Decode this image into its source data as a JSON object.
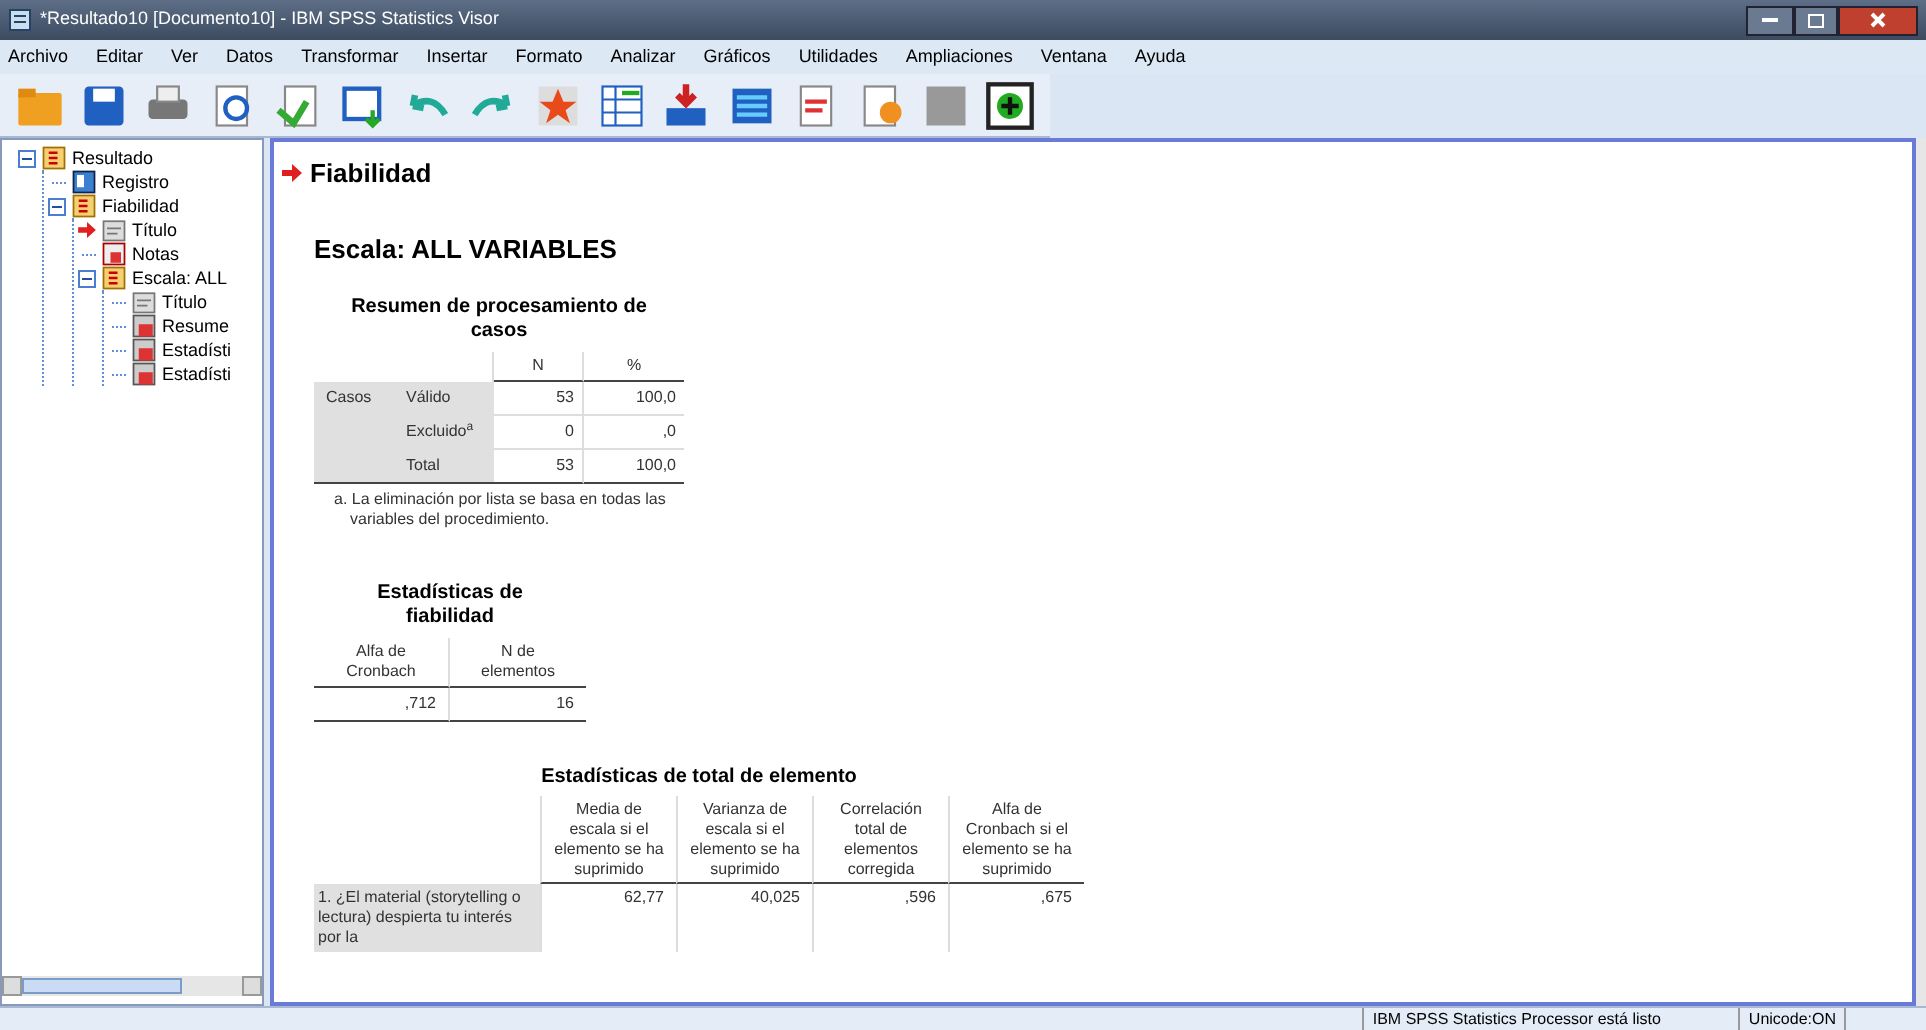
{
  "window": {
    "title": "*Resultado10 [Documento10] - IBM SPSS Statistics Visor"
  },
  "menu": [
    "Archivo",
    "Editar",
    "Ver",
    "Datos",
    "Transformar",
    "Insertar",
    "Formato",
    "Analizar",
    "Gráficos",
    "Utilidades",
    "Ampliaciones",
    "Ventana",
    "Ayuda"
  ],
  "toolbar": [
    {
      "kind": "open"
    },
    {
      "kind": "save"
    },
    {
      "kind": "print"
    },
    {
      "kind": "preview"
    },
    {
      "kind": "export"
    },
    {
      "kind": "recall"
    },
    {
      "kind": "undo"
    },
    {
      "kind": "redo"
    },
    {
      "kind": "star"
    },
    {
      "kind": "goto"
    },
    {
      "kind": "insert"
    },
    {
      "kind": "variables"
    },
    {
      "kind": "doc"
    },
    {
      "kind": "script"
    },
    {
      "kind": "gray"
    },
    {
      "kind": "add"
    }
  ],
  "tree": [
    {
      "label": "Resultado",
      "kind": "log",
      "expanded": true,
      "children": [
        {
          "label": "Registro",
          "kind": "book",
          "selected": false
        },
        {
          "label": "Fiabilidad",
          "kind": "log",
          "expanded": true,
          "children": [
            {
              "label": "Título",
              "kind": "title",
              "selected": true
            },
            {
              "label": "Notas",
              "kind": "notes",
              "selected": false
            },
            {
              "label": "Escala: ALL",
              "kind": "log",
              "expanded": true,
              "children": [
                {
                  "label": "Título",
                  "kind": "title",
                  "selected": false
                },
                {
                  "label": "Resume",
                  "kind": "table",
                  "selected": false
                },
                {
                  "label": "Estadísti",
                  "kind": "table",
                  "selected": false
                },
                {
                  "label": "Estadísti",
                  "kind": "table",
                  "selected": false
                }
              ]
            }
          ]
        }
      ]
    }
  ],
  "output": {
    "heading": "Fiabilidad",
    "subheading": "Escala: ALL VARIABLES",
    "summary": {
      "title": "Resumen de procesamiento de casos",
      "columns": [
        "N",
        "%"
      ],
      "group": "Casos",
      "rows": [
        [
          "Válido",
          "53",
          "100,0"
        ],
        [
          "Excluido$^{a}$",
          "0",
          ",0"
        ],
        [
          "Total",
          "53",
          "100,0"
        ]
      ],
      "footnote": "a. La eliminación por lista se basa en todas las variables del procedimiento."
    },
    "reliability": {
      "title": "Estadísticas de fiabilidad",
      "columns": [
        "Alfa de Cronbach",
        "N de elementos"
      ],
      "row": [
        ",712",
        "16"
      ]
    },
    "item_total": {
      "title": "Estadísticas de total de elemento",
      "columns": [
        "Media de escala si el elemento se ha suprimido",
        "Varianza de escala si el elemento se ha suprimido",
        "Correlación total de elementos corregida",
        "Alfa de Cronbach si el elemento se ha suprimido"
      ],
      "rows": [
        {
          "label": "1. ¿El material (storytelling o lectura) despierta tu interés por la",
          "values": [
            "62,77",
            "40,025",
            ",596",
            ",675"
          ]
        }
      ]
    }
  },
  "status_bar": [
    "IBM SPSS Statistics Processor está listo",
    "Unicode:ON"
  ]
}
